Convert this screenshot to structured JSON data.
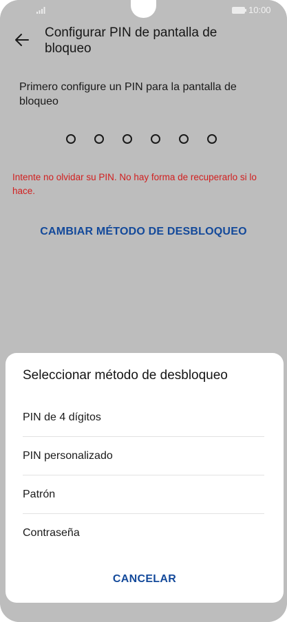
{
  "status_bar": {
    "time": "10:00",
    "icons": [
      "signal-icon",
      "battery-icon"
    ]
  },
  "app_bar": {
    "back_icon": "arrow-left-icon",
    "title": "Configurar PIN de pantalla de bloqueo"
  },
  "content": {
    "instruction": "Primero configure un PIN para la pantalla de bloqueo",
    "pin_length": 6,
    "warning": "Intente no olvidar su PIN. No hay forma de recuperarlo si lo hace.",
    "change_method_label": "CAMBIAR MÉTODO DE DESBLOQUEO"
  },
  "sheet": {
    "title": "Seleccionar método de desbloqueo",
    "options": [
      "PIN de 4 dígitos",
      "PIN personalizado",
      "Patrón",
      "Contraseña"
    ],
    "cancel_label": "CANCELAR"
  },
  "colors": {
    "background_dim": "#bdbdbd",
    "accent": "#13499a",
    "warning": "#d11f1f",
    "sheet": "#ffffff"
  }
}
